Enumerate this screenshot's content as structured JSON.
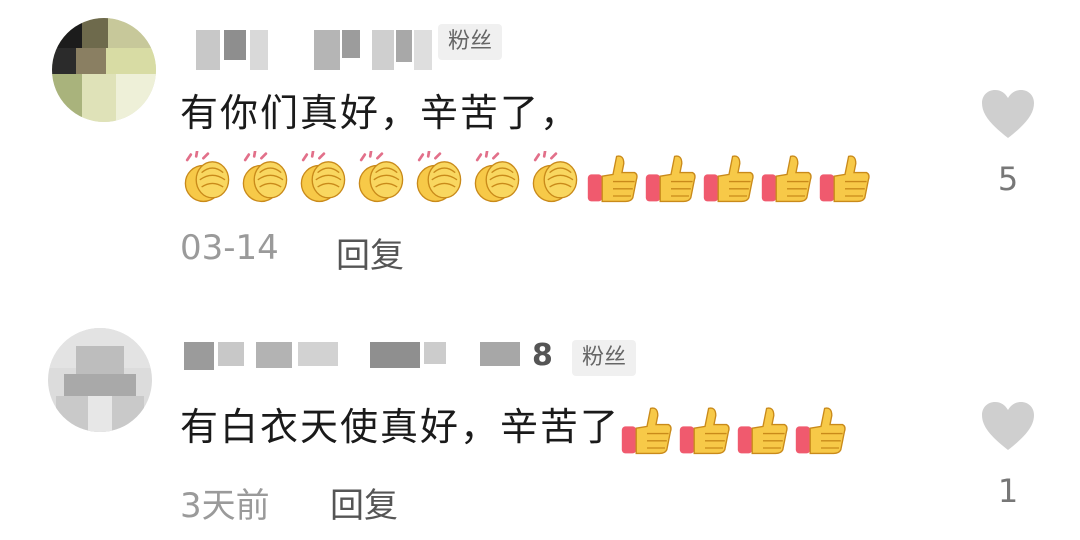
{
  "comments": [
    {
      "badge": "粉丝",
      "text": "有你们真好，辛苦了，",
      "emojis": [
        "clap",
        "clap",
        "clap",
        "clap",
        "clap",
        "clap",
        "clap",
        "thumb",
        "thumb",
        "thumb",
        "thumb",
        "thumb"
      ],
      "date": "03-14",
      "reply_label": "回复",
      "likes": "5"
    },
    {
      "name_suffix": "8",
      "badge": "粉丝",
      "text": "有白衣天使真好，辛苦了",
      "emojis": [
        "thumb",
        "thumb",
        "thumb",
        "thumb"
      ],
      "date": "3天前",
      "reply_label": "回复",
      "likes": "1"
    }
  ],
  "icons": {
    "like": "heart-icon",
    "clap": "clapping-hands-icon",
    "thumb": "thumbs-up-icon"
  },
  "colors": {
    "heart": "#cfcfcf",
    "clap": "#f7c948",
    "thumb": "#f7c948",
    "cuff": "#f05a6e"
  }
}
